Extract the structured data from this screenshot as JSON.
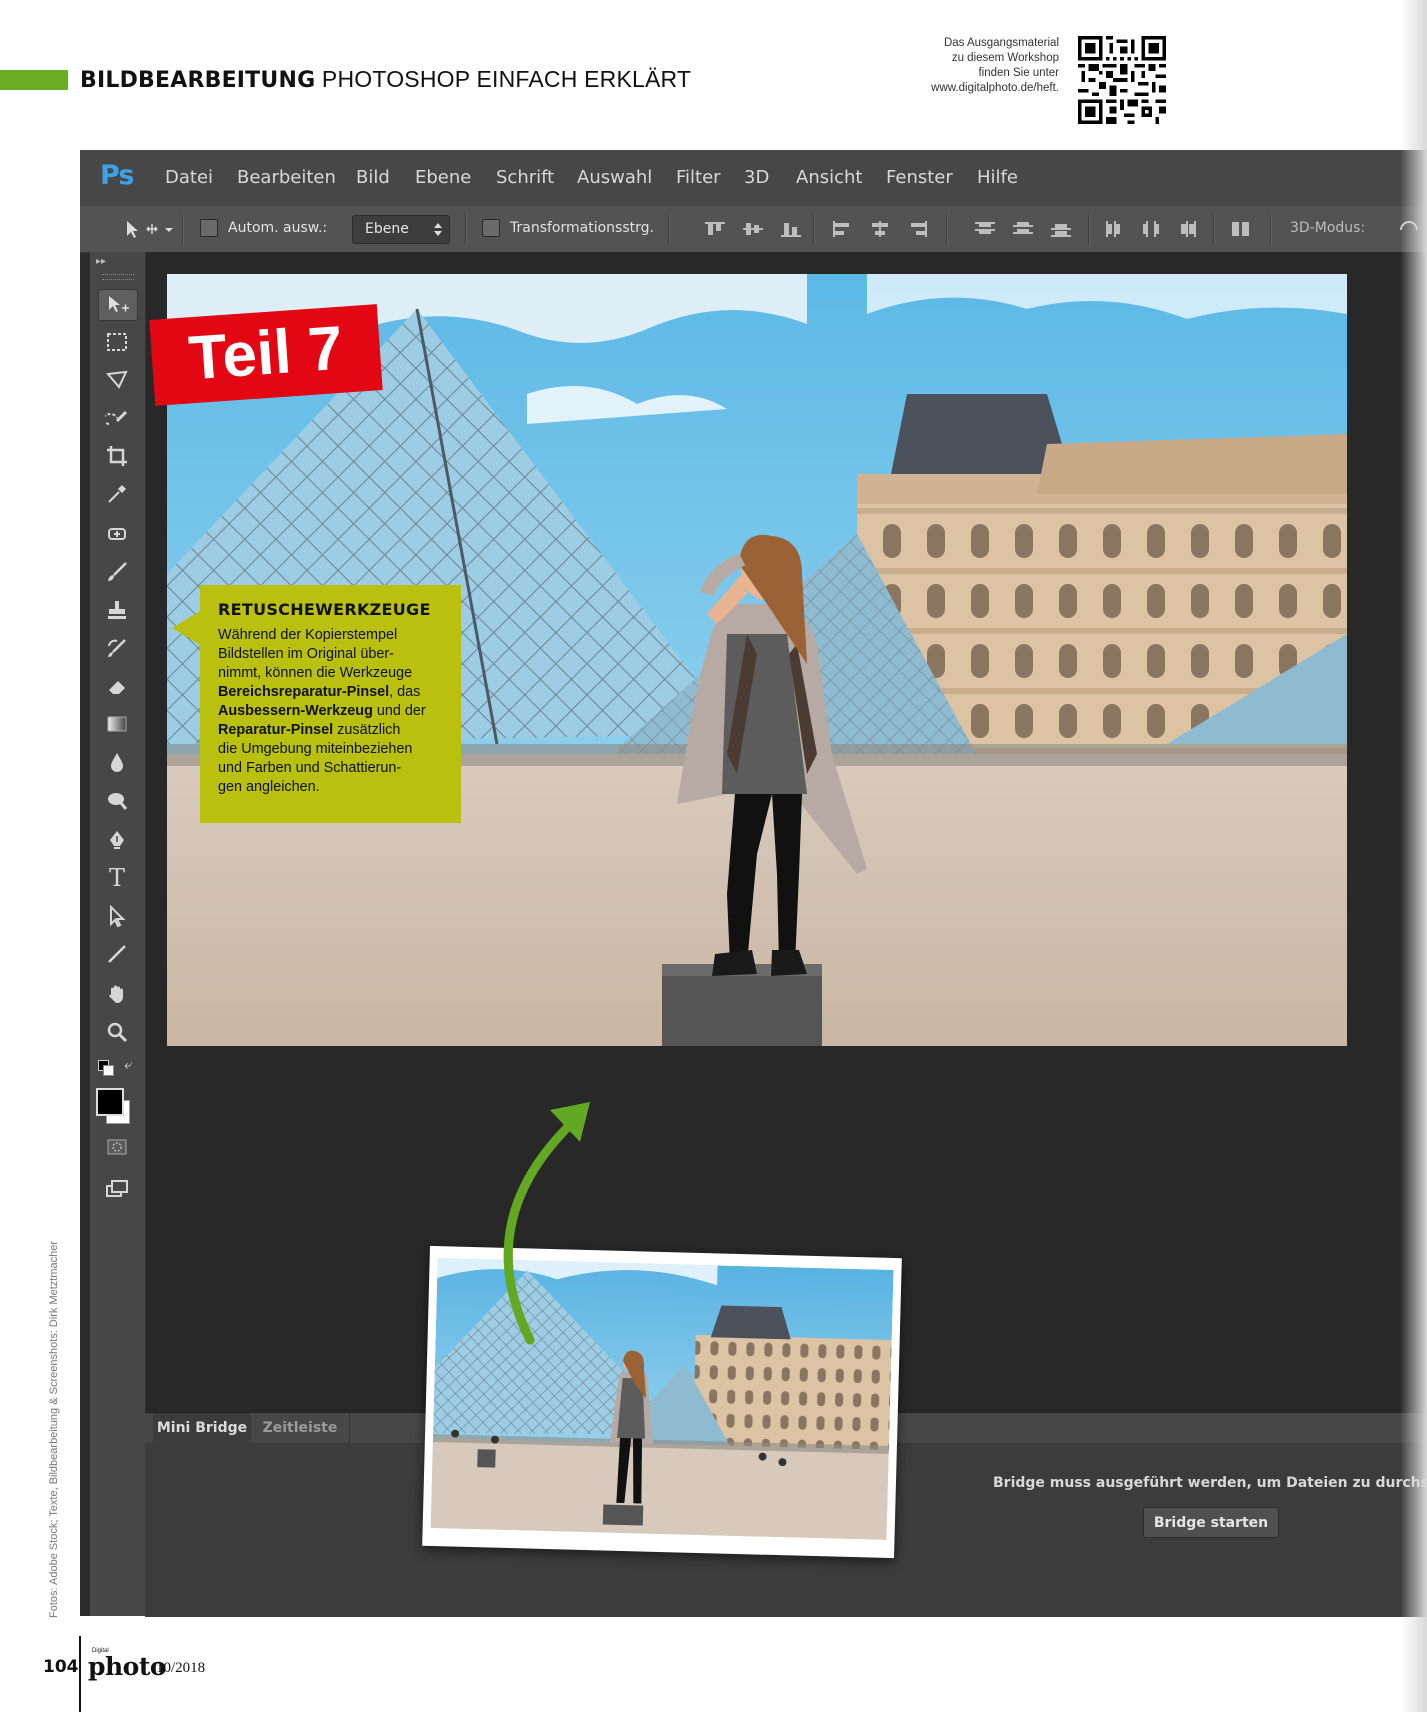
{
  "header": {
    "section": "BILDBEARBEITUNG",
    "subtitle": "PHOTOSHOP EINFACH ERKLÄRT",
    "qr_note_1": "Das Ausgangsmaterial",
    "qr_note_2": "zu diesem Workshop",
    "qr_note_3": "finden Sie unter",
    "qr_note_4": "www.digitalphoto.de/heft."
  },
  "photoshop": {
    "logo": "Ps",
    "menu": [
      "Datei",
      "Bearbeiten",
      "Bild",
      "Ebene",
      "Schrift",
      "Auswahl",
      "Filter",
      "3D",
      "Ansicht",
      "Fenster",
      "Hilfe"
    ],
    "options": {
      "auto_select_label": "Autom. ausw.:",
      "auto_select_value": "Ebene",
      "transform_label": "Transformationsstrg.",
      "mode_label": "3D-Modus:"
    },
    "panel": {
      "tab_active": "Mini Bridge",
      "tab_inactive": "Zeitleiste",
      "message": "Bridge muss ausgeführt werden, um Dateien zu durchsuchen",
      "button": "Bridge starten"
    }
  },
  "badge": {
    "text": "Teil 7"
  },
  "callout": {
    "title": "RETUSCHEWERKZEUGE",
    "line1": "Während der Kopierstempel",
    "line2": "Bildstellen im Original über-",
    "line3": "nimmt, können die Werkzeuge",
    "bold1": "Bereichsreparatur-Pinsel",
    "text_das": ", das",
    "bold2": "Ausbessern-Werkzeug",
    "text_und": " und der",
    "bold3": "Reparatur-Pinsel",
    "text_zus": " zusätzlich",
    "line7": "die Umgebung miteinbeziehen",
    "line8": "und Farben und Schattierun-",
    "line9": "gen angleichen."
  },
  "credits": "Fotos: Adobe Stock; Texte, Bildbearbeitung & Screenshots: Dirk Metztmacher",
  "footer": {
    "page_number": "104",
    "mag_small": "Digital",
    "mag_name": "photo",
    "issue": "10/2018"
  },
  "colors": {
    "accent_green": "#6aac22",
    "callout_yellow": "#b9c00e",
    "badge_red": "#e30613",
    "ps_blue": "#3ea2e8"
  }
}
